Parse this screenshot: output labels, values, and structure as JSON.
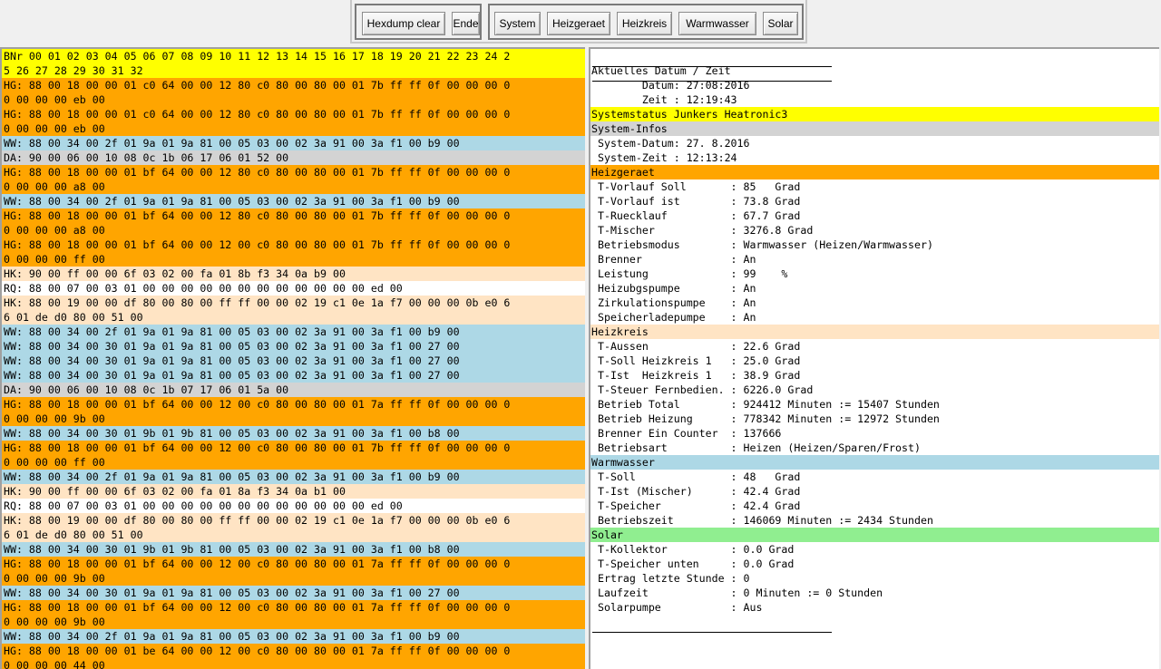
{
  "colors": {
    "hg": "#ffa500",
    "ww": "#add8e6",
    "da": "#d3d3d3",
    "hk": "#ffe4c4",
    "rq": "#ffffff",
    "header": "#ffff00",
    "solar": "#90ee90",
    "plain": "#ffffff"
  },
  "toolbar": {
    "hexdump_clear": "Hexdump clear",
    "ende": "Ende",
    "system": "System",
    "heizgeraet": "Heizgeraet",
    "heizkreis": "Heizkreis",
    "warmwasser": "Warmwasser",
    "solar": "Solar"
  },
  "hexdump": {
    "lines": [
      {
        "t": "BNr 00 01 02 03 04 05 06 07 08 09 10 11 12 13 14 15 16 17 18 19 20 21 22 23 24 2",
        "c": "header"
      },
      {
        "t": "5 26 27 28 29 30 31 32",
        "c": "header"
      },
      {
        "t": "HG: 88 00 18 00 00 01 c0 64 00 00 12 80 c0 80 00 80 00 01 7b ff ff 0f 00 00 00 0",
        "c": "hg"
      },
      {
        "t": "0 00 00 00 eb 00",
        "c": "hg"
      },
      {
        "t": "HG: 88 00 18 00 00 01 c0 64 00 00 12 80 c0 80 00 80 00 01 7b ff ff 0f 00 00 00 0",
        "c": "hg"
      },
      {
        "t": "0 00 00 00 eb 00",
        "c": "hg"
      },
      {
        "t": "WW: 88 00 34 00 2f 01 9a 01 9a 81 00 05 03 00 02 3a 91 00 3a f1 00 b9 00",
        "c": "ww"
      },
      {
        "t": "DA: 90 00 06 00 10 08 0c 1b 06 17 06 01 52 00",
        "c": "da"
      },
      {
        "t": "HG: 88 00 18 00 00 01 bf 64 00 00 12 80 c0 80 00 80 00 01 7b ff ff 0f 00 00 00 0",
        "c": "hg"
      },
      {
        "t": "0 00 00 00 a8 00",
        "c": "hg"
      },
      {
        "t": "WW: 88 00 34 00 2f 01 9a 01 9a 81 00 05 03 00 02 3a 91 00 3a f1 00 b9 00",
        "c": "ww"
      },
      {
        "t": "HG: 88 00 18 00 00 01 bf 64 00 00 12 80 c0 80 00 80 00 01 7b ff ff 0f 00 00 00 0",
        "c": "hg"
      },
      {
        "t": "0 00 00 00 a8 00",
        "c": "hg"
      },
      {
        "t": "HG: 88 00 18 00 00 01 bf 64 00 00 12 00 c0 80 00 80 00 01 7b ff ff 0f 00 00 00 0",
        "c": "hg"
      },
      {
        "t": "0 00 00 00 ff 00",
        "c": "hg"
      },
      {
        "t": "HK: 90 00 ff 00 00 6f 03 02 00 fa 01 8b f3 34 0a b9 00",
        "c": "hk"
      },
      {
        "t": "RQ: 88 00 07 00 03 01 00 00 00 00 00 00 00 00 00 00 00 00 ed 00",
        "c": "rq"
      },
      {
        "t": "HK: 88 00 19 00 00 df 80 00 80 00 ff ff 00 00 02 19 c1 0e 1a f7 00 00 00 0b e0 6",
        "c": "hk"
      },
      {
        "t": "6 01 de d0 80 00 51 00",
        "c": "hk"
      },
      {
        "t": "WW: 88 00 34 00 2f 01 9a 01 9a 81 00 05 03 00 02 3a 91 00 3a f1 00 b9 00",
        "c": "ww"
      },
      {
        "t": "WW: 88 00 34 00 30 01 9a 01 9a 81 00 05 03 00 02 3a 91 00 3a f1 00 27 00",
        "c": "ww"
      },
      {
        "t": "WW: 88 00 34 00 30 01 9a 01 9a 81 00 05 03 00 02 3a 91 00 3a f1 00 27 00",
        "c": "ww"
      },
      {
        "t": "WW: 88 00 34 00 30 01 9a 01 9a 81 00 05 03 00 02 3a 91 00 3a f1 00 27 00",
        "c": "ww"
      },
      {
        "t": "DA: 90 00 06 00 10 08 0c 1b 07 17 06 01 5a 00",
        "c": "da"
      },
      {
        "t": "HG: 88 00 18 00 00 01 bf 64 00 00 12 00 c0 80 00 80 00 01 7a ff ff 0f 00 00 00 0",
        "c": "hg"
      },
      {
        "t": "0 00 00 00 9b 00",
        "c": "hg"
      },
      {
        "t": "WW: 88 00 34 00 30 01 9b 01 9b 81 00 05 03 00 02 3a 91 00 3a f1 00 b8 00",
        "c": "ww"
      },
      {
        "t": "HG: 88 00 18 00 00 01 bf 64 00 00 12 00 c0 80 00 80 00 01 7b ff ff 0f 00 00 00 0",
        "c": "hg"
      },
      {
        "t": "0 00 00 00 ff 00",
        "c": "hg"
      },
      {
        "t": "WW: 88 00 34 00 2f 01 9a 01 9a 81 00 05 03 00 02 3a 91 00 3a f1 00 b9 00",
        "c": "ww"
      },
      {
        "t": "HK: 90 00 ff 00 00 6f 03 02 00 fa 01 8a f3 34 0a b1 00",
        "c": "hk"
      },
      {
        "t": "RQ: 88 00 07 00 03 01 00 00 00 00 00 00 00 00 00 00 00 00 ed 00",
        "c": "rq"
      },
      {
        "t": "HK: 88 00 19 00 00 df 80 00 80 00 ff ff 00 00 02 19 c1 0e 1a f7 00 00 00 0b e0 6",
        "c": "hk"
      },
      {
        "t": "6 01 de d0 80 00 51 00",
        "c": "hk"
      },
      {
        "t": "WW: 88 00 34 00 30 01 9b 01 9b 81 00 05 03 00 02 3a 91 00 3a f1 00 b8 00",
        "c": "ww"
      },
      {
        "t": "HG: 88 00 18 00 00 01 bf 64 00 00 12 00 c0 80 00 80 00 01 7a ff ff 0f 00 00 00 0",
        "c": "hg"
      },
      {
        "t": "0 00 00 00 9b 00",
        "c": "hg"
      },
      {
        "t": "WW: 88 00 34 00 30 01 9a 01 9a 81 00 05 03 00 02 3a 91 00 3a f1 00 27 00",
        "c": "ww"
      },
      {
        "t": "HG: 88 00 18 00 00 01 bf 64 00 00 12 00 c0 80 00 80 00 01 7a ff ff 0f 00 00 00 0",
        "c": "hg"
      },
      {
        "t": "0 00 00 00 9b 00",
        "c": "hg"
      },
      {
        "t": "WW: 88 00 34 00 2f 01 9a 01 9a 81 00 05 03 00 02 3a 91 00 3a f1 00 b9 00",
        "c": "ww"
      },
      {
        "t": "HG: 88 00 18 00 00 01 be 64 00 00 12 00 c0 80 00 80 00 01 7a ff ff 0f 00 00 00 0",
        "c": "hg"
      },
      {
        "t": "0 00 00 00 44 00",
        "c": "hg"
      }
    ]
  },
  "status": {
    "lines": [
      {
        "t": "",
        "c": "plain"
      },
      {
        "t": "Aktuelles Datum / Zeit",
        "c": "plain"
      },
      {
        "t": "        Datum: 27:08:2016",
        "c": "plain"
      },
      {
        "t": "        Zeit : 12:19:43",
        "c": "plain"
      },
      {
        "t": "Systemstatus Junkers Heatronic3",
        "c": "header"
      },
      {
        "t": "System-Infos",
        "c": "da"
      },
      {
        "t": " System-Datum: 27. 8.2016",
        "c": "plain"
      },
      {
        "t": " System-Zeit : 12:13:24",
        "c": "plain"
      },
      {
        "t": "Heizgeraet",
        "c": "hg"
      },
      {
        "t": " T-Vorlauf Soll       : 85   Grad",
        "c": "plain"
      },
      {
        "t": " T-Vorlauf ist        : 73.8 Grad",
        "c": "plain"
      },
      {
        "t": " T-Ruecklauf          : 67.7 Grad",
        "c": "plain"
      },
      {
        "t": " T-Mischer            : 3276.8 Grad",
        "c": "plain"
      },
      {
        "t": " Betriebsmodus        : Warmwasser (Heizen/Warmwasser)",
        "c": "plain"
      },
      {
        "t": " Brenner              : An",
        "c": "plain"
      },
      {
        "t": " Leistung             : 99    %",
        "c": "plain"
      },
      {
        "t": " Heizubgspumpe        : An",
        "c": "plain"
      },
      {
        "t": " Zirkulationspumpe    : An",
        "c": "plain"
      },
      {
        "t": " Speicherladepumpe    : An",
        "c": "plain"
      },
      {
        "t": "Heizkreis",
        "c": "hk"
      },
      {
        "t": " T-Aussen             : 22.6 Grad",
        "c": "plain"
      },
      {
        "t": " T-Soll Heizkreis 1   : 25.0 Grad",
        "c": "plain"
      },
      {
        "t": " T-Ist  Heizkreis 1   : 38.9 Grad",
        "c": "plain"
      },
      {
        "t": " T-Steuer Fernbedien. : 6226.0 Grad",
        "c": "plain"
      },
      {
        "t": " Betrieb Total        : 924412 Minuten := 15407 Stunden",
        "c": "plain"
      },
      {
        "t": " Betrieb Heizung      : 778342 Minuten := 12972 Stunden",
        "c": "plain"
      },
      {
        "t": " Brenner Ein Counter  : 137666",
        "c": "plain"
      },
      {
        "t": " Betriebsart          : Heizen (Heizen/Sparen/Frost)",
        "c": "plain"
      },
      {
        "t": "Warmwasser",
        "c": "ww"
      },
      {
        "t": " T-Soll               : 48   Grad",
        "c": "plain"
      },
      {
        "t": " T-Ist (Mischer)      : 42.4 Grad",
        "c": "plain"
      },
      {
        "t": " T-Speicher           : 42.4 Grad",
        "c": "plain"
      },
      {
        "t": " Betriebszeit         : 146069 Minuten := 2434 Stunden",
        "c": "plain"
      },
      {
        "t": "Solar",
        "c": "solar"
      },
      {
        "t": " T-Kollektor          : 0.0 Grad",
        "c": "plain"
      },
      {
        "t": " T-Speicher unten     : 0.0 Grad",
        "c": "plain"
      },
      {
        "t": " Ertrag letzte Stunde : 0",
        "c": "plain"
      },
      {
        "t": " Laufzeit             : 0 Minuten := 0 Stunden",
        "c": "plain"
      },
      {
        "t": " Solarpumpe           : Aus",
        "c": "plain"
      }
    ]
  }
}
